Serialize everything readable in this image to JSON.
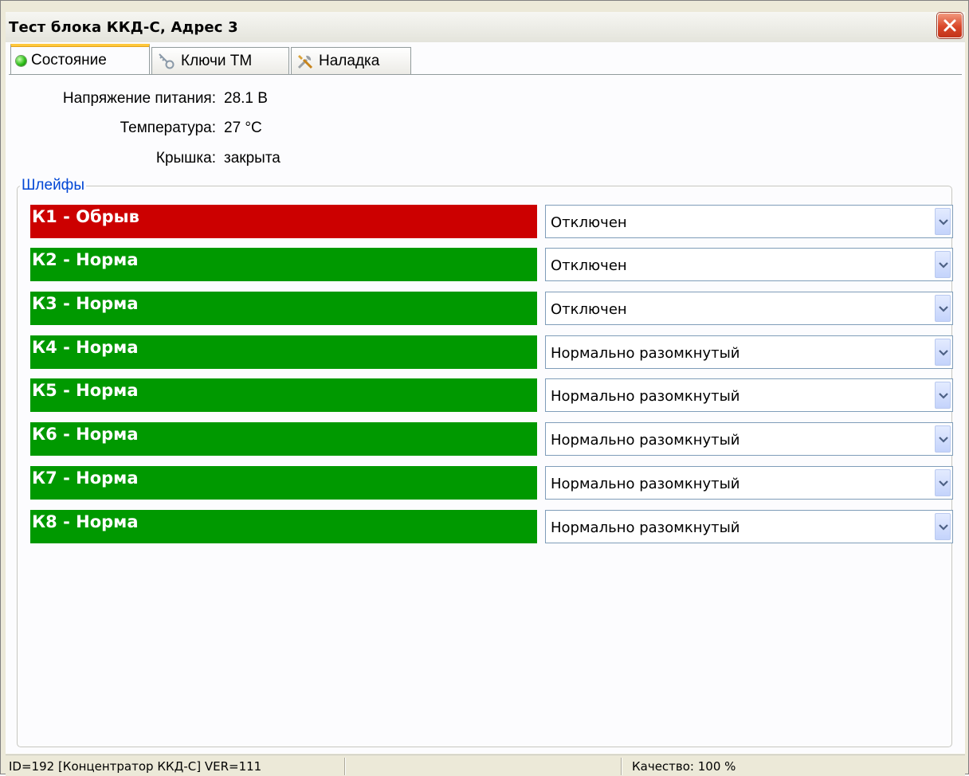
{
  "window": {
    "title": "Тест блока ККД-С, Адрес 3"
  },
  "tabs": [
    {
      "label": "Состояние",
      "icon": "green-led-icon",
      "active": true
    },
    {
      "label": "Ключи ТМ",
      "icon": "key-icon",
      "active": false
    },
    {
      "label": "Наладка",
      "icon": "tools-icon",
      "active": false
    }
  ],
  "status": {
    "voltage": {
      "label": "Напряжение питания:",
      "value": "28.1 В"
    },
    "temperature": {
      "label": "Температура:",
      "value": "27 °C"
    },
    "lid": {
      "label": "Крышка:",
      "value": "закрыта"
    }
  },
  "loops": {
    "title": "Шлейфы",
    "items": [
      {
        "label": "К1 - Обрыв",
        "state": "bad",
        "mode": "Отключен"
      },
      {
        "label": "К2 - Норма",
        "state": "ok",
        "mode": "Отключен"
      },
      {
        "label": "К3 - Норма",
        "state": "ok",
        "mode": "Отключен"
      },
      {
        "label": "К4 - Норма",
        "state": "ok",
        "mode": "Нормально разомкнутый"
      },
      {
        "label": "К5 - Норма",
        "state": "ok",
        "mode": "Нормально разомкнутый"
      },
      {
        "label": "К6 - Норма",
        "state": "ok",
        "mode": "Нормально разомкнутый"
      },
      {
        "label": "К7 - Норма",
        "state": "ok",
        "mode": "Нормально разомкнутый"
      },
      {
        "label": "К8 - Норма",
        "state": "ok",
        "mode": "Нормально разомкнутый"
      }
    ]
  },
  "statusbar": {
    "device": "ID=192 [Концентратор ККД-С]  VER=111",
    "quality": "Качество: 100 %"
  },
  "colors": {
    "fault": "#cc0000",
    "normal": "#009900",
    "group_title": "#0046d5"
  }
}
